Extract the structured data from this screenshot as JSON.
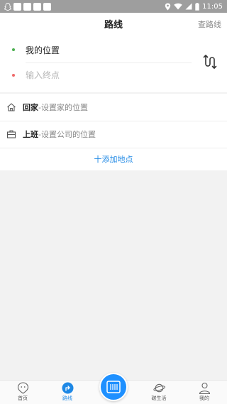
{
  "status_bar": {
    "time": "11:05"
  },
  "header": {
    "title": "路线",
    "action": "查路线"
  },
  "route": {
    "start_label": "我的位置",
    "end_placeholder": "输入终点",
    "end_value": ""
  },
  "places": {
    "home": {
      "name": "回家",
      "separator": " - ",
      "desc": "设置家的位置"
    },
    "work": {
      "name": "上班",
      "separator": " - ",
      "desc": "设置公司的位置"
    },
    "add_label": "十添加地点"
  },
  "tabbar": {
    "home": "首页",
    "route": "路线",
    "life": "碳生活",
    "me": "我的"
  },
  "colors": {
    "accent": "#1e88e5",
    "start_dot": "#4caf50",
    "end_dot": "#ef6a6a"
  },
  "icons": [
    "snapchat-icon",
    "location-icon",
    "wifi-icon",
    "signal-icon",
    "battery-icon",
    "swap-route-icon",
    "home-icon",
    "briefcase-icon",
    "home-tab-icon",
    "route-tab-icon",
    "scan-icon",
    "planet-icon",
    "person-icon"
  ]
}
